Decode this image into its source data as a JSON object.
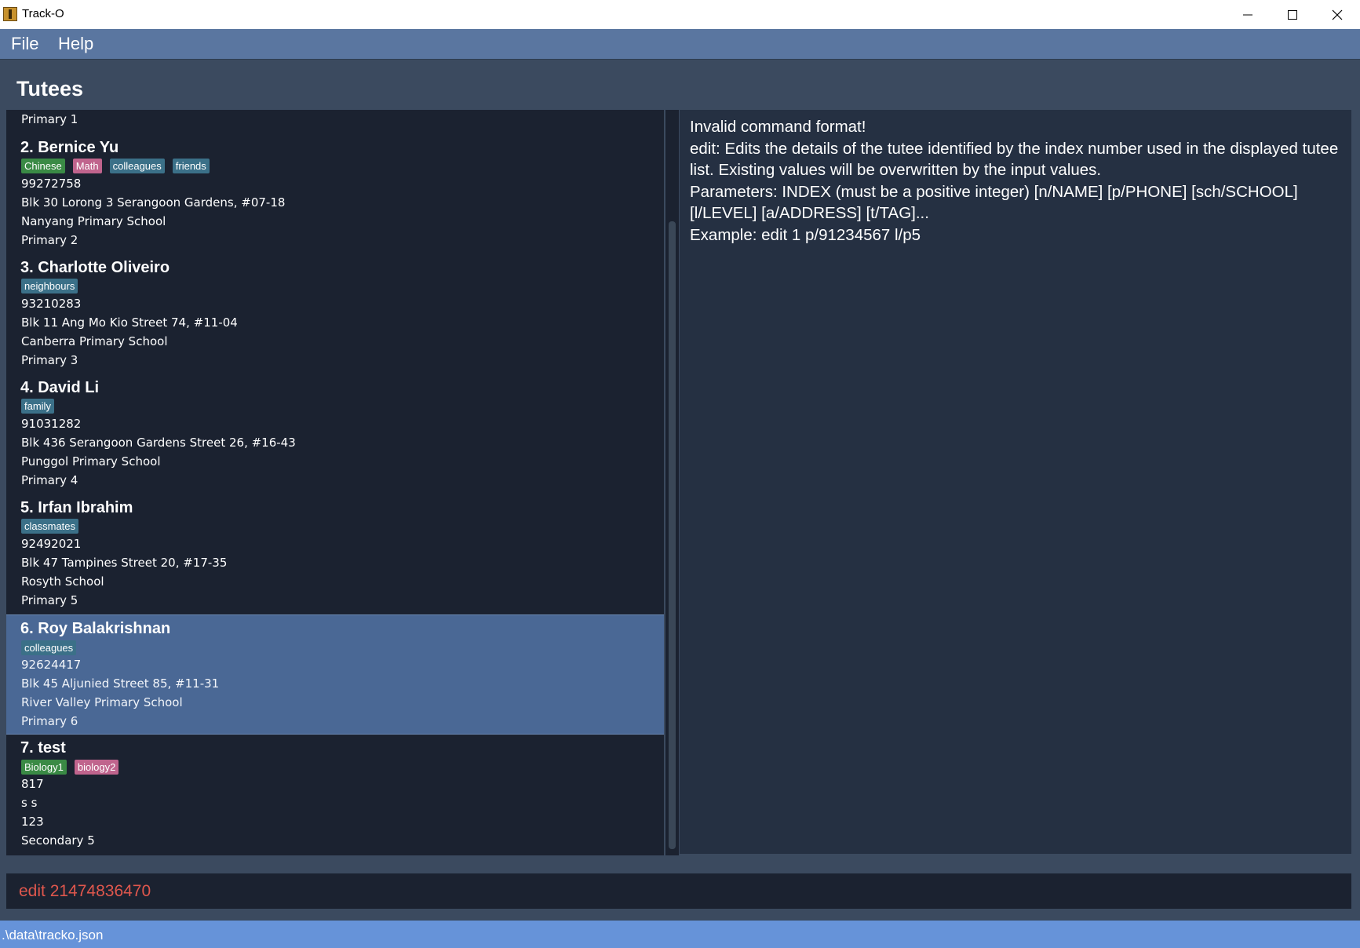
{
  "window": {
    "title": "Track-O"
  },
  "menu": {
    "file": "File",
    "help": "Help"
  },
  "section_title": "Tutees",
  "tutees": [
    {
      "level": "Primary 1"
    },
    {
      "name": "2.  Bernice Yu",
      "tags": [
        {
          "label": "Chinese",
          "color": "green"
        },
        {
          "label": "Math",
          "color": "pink"
        },
        {
          "label": "colleagues",
          "color": "teal"
        },
        {
          "label": "friends",
          "color": "teal"
        }
      ],
      "phone": "99272758",
      "address": "Blk 30 Lorong 3 Serangoon Gardens, #07-18",
      "school": "Nanyang Primary School",
      "level": "Primary 2"
    },
    {
      "name": "3.  Charlotte Oliveiro",
      "tags": [
        {
          "label": "neighbours",
          "color": "teal"
        }
      ],
      "phone": "93210283",
      "address": "Blk 11 Ang Mo Kio Street 74, #11-04",
      "school": "Canberra Primary School",
      "level": "Primary 3"
    },
    {
      "name": "4.  David Li",
      "tags": [
        {
          "label": "family",
          "color": "teal"
        }
      ],
      "phone": "91031282",
      "address": "Blk 436 Serangoon Gardens Street 26, #16-43",
      "school": "Punggol Primary School",
      "level": "Primary 4"
    },
    {
      "name": "5.  Irfan Ibrahim",
      "tags": [
        {
          "label": "classmates",
          "color": "teal"
        }
      ],
      "phone": "92492021",
      "address": "Blk 47 Tampines Street 20, #17-35",
      "school": "Rosyth School",
      "level": "Primary 5"
    },
    {
      "name": "6.  Roy Balakrishnan",
      "tags": [
        {
          "label": "colleagues",
          "color": "teal"
        }
      ],
      "phone": "92624417",
      "address": "Blk 45 Aljunied Street 85, #11-31",
      "school": "River Valley Primary School",
      "level": "Primary 6",
      "selected": true
    },
    {
      "name": "7.  test",
      "tags": [
        {
          "label": "Biology1",
          "color": "green"
        },
        {
          "label": "biology2",
          "color": "pink"
        }
      ],
      "phone": "817",
      "address": "s s",
      "school": "123",
      "level": "Secondary 5"
    }
  ],
  "result": {
    "text": "Invalid command format!\nedit: Edits the details of the tutee identified by the index number used in the displayed tutee list. Existing values will be overwritten by the input values.\nParameters: INDEX (must be a positive integer) [n/NAME] [p/PHONE] [sch/SCHOOL] [l/LEVEL] [a/ADDRESS] [t/TAG]...\nExample: edit 1 p/91234567 l/p5"
  },
  "command": {
    "value": "edit 21474836470"
  },
  "status": {
    "path": ".\\data\\tracko.json"
  },
  "colors": {
    "menubar": "#5a76a0",
    "panel": "#1b2230",
    "selected": "#4a6895",
    "error_text": "#e0574d",
    "statusbar": "#6693d9"
  }
}
